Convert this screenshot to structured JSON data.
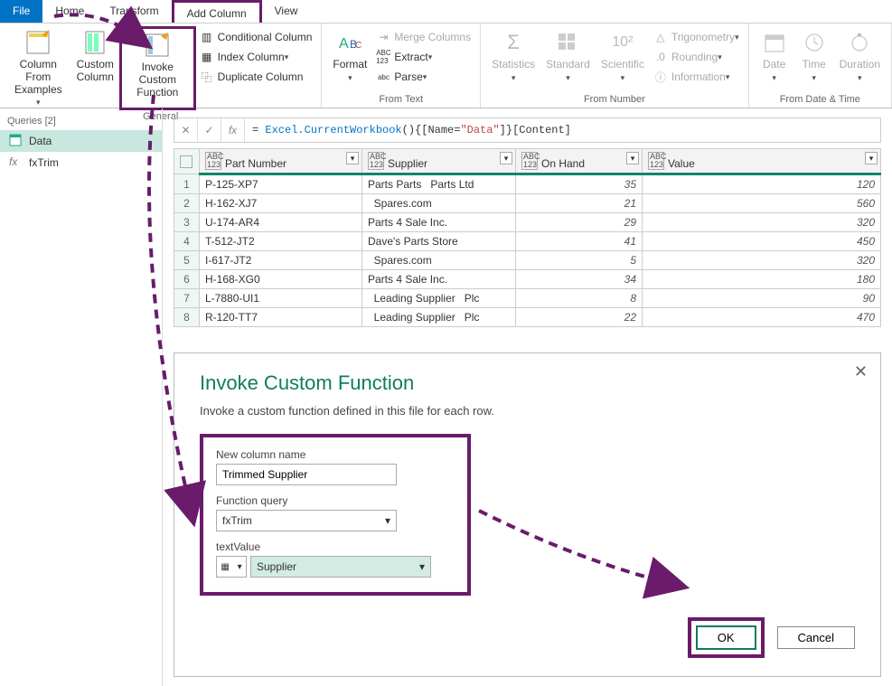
{
  "tabs": {
    "file": "File",
    "home": "Home",
    "transform": "Transform",
    "add_column": "Add Column",
    "view": "View"
  },
  "ribbon": {
    "general": {
      "label": "General",
      "col_from_examples": "Column From\nExamples",
      "custom_column": "Custom\nColumn",
      "invoke_custom": "Invoke Custom\nFunction",
      "conditional": "Conditional Column",
      "index": "Index Column",
      "duplicate": "Duplicate Column"
    },
    "from_text": {
      "label": "From Text",
      "format": "Format",
      "merge": "Merge Columns",
      "extract": "Extract",
      "parse": "Parse"
    },
    "from_number": {
      "label": "From Number",
      "statistics": "Statistics",
      "standard": "Standard",
      "scientific": "Scientific",
      "trig": "Trigonometry",
      "rounding": "Rounding",
      "information": "Information"
    },
    "from_dt": {
      "label": "From Date & Time",
      "date": "Date",
      "time": "Time",
      "duration": "Duration"
    }
  },
  "sidebar": {
    "header": "Queries [2]",
    "items": [
      {
        "label": "Data"
      },
      {
        "label": "fxTrim"
      }
    ]
  },
  "formula_prefix": "= ",
  "formula_func": "Excel.CurrentWorkbook",
  "formula_mid1": "(){[Name=",
  "formula_str": "\"Data\"",
  "formula_mid2": "]}[Content]",
  "columns": [
    "Part Number",
    "Supplier",
    "On Hand",
    "Value"
  ],
  "col_type": "ABC\n123",
  "rows": [
    {
      "n": 1,
      "part": "P-125-XP7",
      "supp": "Parts Parts   Parts Ltd",
      "onhand": "35",
      "val": "120"
    },
    {
      "n": 2,
      "part": "H-162-XJ7",
      "supp": "  Spares.com",
      "onhand": "21",
      "val": "560"
    },
    {
      "n": 3,
      "part": "U-174-AR4",
      "supp": "Parts 4 Sale Inc.",
      "onhand": "29",
      "val": "320"
    },
    {
      "n": 4,
      "part": "T-512-JT2",
      "supp": "Dave's Parts Store",
      "onhand": "41",
      "val": "450"
    },
    {
      "n": 5,
      "part": "I-617-JT2",
      "supp": "  Spares.com",
      "onhand": "5",
      "val": "320"
    },
    {
      "n": 6,
      "part": "H-168-XG0",
      "supp": "Parts 4 Sale Inc.",
      "onhand": "34",
      "val": "180"
    },
    {
      "n": 7,
      "part": "L-7880-UI1",
      "supp": "  Leading Supplier   Plc",
      "onhand": "8",
      "val": "90"
    },
    {
      "n": 8,
      "part": "R-120-TT7",
      "supp": "  Leading Supplier   Plc",
      "onhand": "22",
      "val": "470"
    }
  ],
  "dialog": {
    "title": "Invoke Custom Function",
    "subtitle": "Invoke a custom function defined in this file for each row.",
    "new_col_label": "New column name",
    "new_col_value": "Trimmed Supplier",
    "fq_label": "Function query",
    "fq_value": "fxTrim",
    "tv_label": "textValue",
    "tv_value": "Supplier",
    "ok": "OK",
    "cancel": "Cancel"
  }
}
